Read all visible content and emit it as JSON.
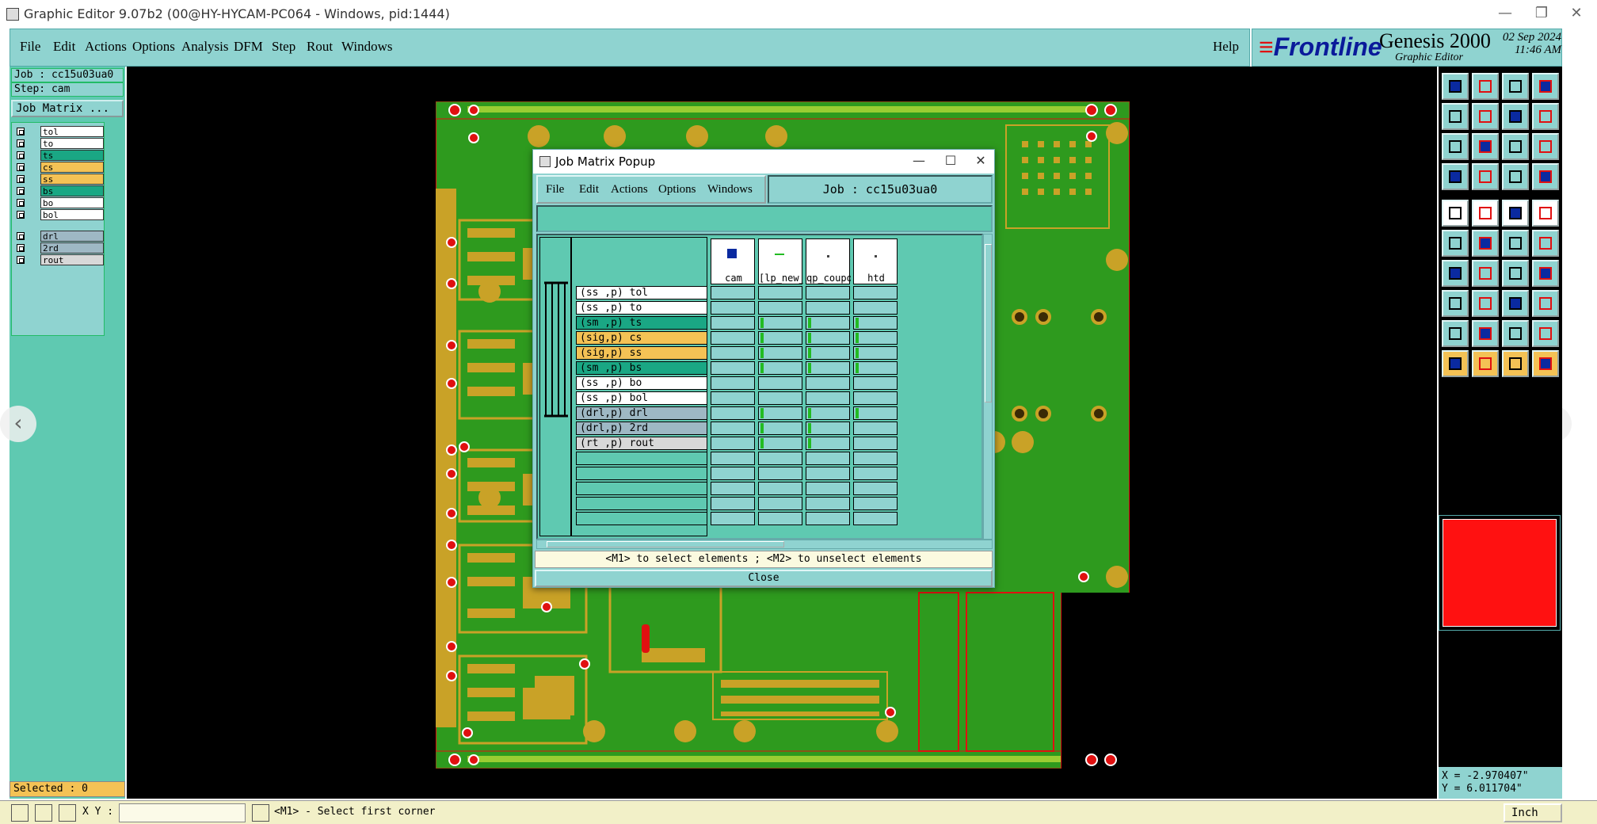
{
  "window": {
    "title": "Graphic Editor 9.07b2 (00@HY-HYCAM-PC064 - Windows, pid:1444)",
    "controls": [
      "—",
      "❐",
      "✕"
    ]
  },
  "menubar": {
    "items": [
      "File",
      "Edit",
      "Actions",
      "Options",
      "Analysis",
      "DFM",
      "Step",
      "Rout",
      "Windows"
    ],
    "help": "Help"
  },
  "brand": {
    "logo": "Frontline",
    "product": "Genesis 2000",
    "subtitle": "Graphic Editor",
    "date": "02 Sep 2024",
    "time": "11:46 AM"
  },
  "left_panel": {
    "job": "Job : cc15u03ua0",
    "step": "Step: cam",
    "job_matrix_button": "Job Matrix ...",
    "layers": [
      {
        "name": "tol",
        "color": "#ffffff"
      },
      {
        "name": "to",
        "color": "#ffffff"
      },
      {
        "name": "ts",
        "color": "#1aa784"
      },
      {
        "name": "cs",
        "color": "#f4c255"
      },
      {
        "name": "ss",
        "color": "#f4c255"
      },
      {
        "name": "bs",
        "color": "#1aa784"
      },
      {
        "name": "bo",
        "color": "#ffffff"
      },
      {
        "name": "bol",
        "color": "#ffffff"
      },
      {
        "name": "drl",
        "color": "#9eb8c4"
      },
      {
        "name": "2rd",
        "color": "#9eb8c4"
      },
      {
        "name": "rout",
        "color": "#d8d8d8"
      }
    ],
    "selected": "Selected : 0"
  },
  "popup": {
    "title": "Job Matrix Popup",
    "controls": [
      "—",
      "☐",
      "✕"
    ],
    "menu": [
      "File",
      "Edit",
      "Actions",
      "Options",
      "Windows"
    ],
    "job_label": "Job : cc15u03ua0",
    "columns": [
      "cam",
      "[lp_new_]",
      "qp_coupo",
      "htd"
    ],
    "rows": [
      {
        "label": "(ss ,p) tol",
        "color": "#ffffff"
      },
      {
        "label": "(ss ,p) to",
        "color": "#ffffff"
      },
      {
        "label": "(sm ,p) ts",
        "color": "#1aa784"
      },
      {
        "label": "(sig,p) cs",
        "color": "#f4c255"
      },
      {
        "label": "(sig,p) ss",
        "color": "#f4c255"
      },
      {
        "label": "(sm ,p) bs",
        "color": "#1aa784"
      },
      {
        "label": "(ss ,p) bo",
        "color": "#ffffff"
      },
      {
        "label": "(ss ,p) bol",
        "color": "#ffffff"
      },
      {
        "label": "(drl,p) drl",
        "color": "#9eb8c4"
      },
      {
        "label": "(drl,p) 2rd",
        "color": "#9eb8c4"
      },
      {
        "label": "(rt ,p) rout",
        "color": "#d8d8d8"
      }
    ],
    "hint": "<M1> to select elements ; <M2> to unselect elements",
    "close": "Close"
  },
  "coords": {
    "x": "X = -2.970407\"",
    "y": "Y = 6.011704\""
  },
  "statusbar": {
    "xy_label": "X Y :",
    "message": "<M1> - Select first corner",
    "unit": "Inch"
  },
  "colors": {
    "teal_ui": "#8fd3d0",
    "panel_green": "#5fc9b1",
    "board_green": "#2e9a1e",
    "copper": "#c9a227",
    "pad_red": "#e01010"
  }
}
